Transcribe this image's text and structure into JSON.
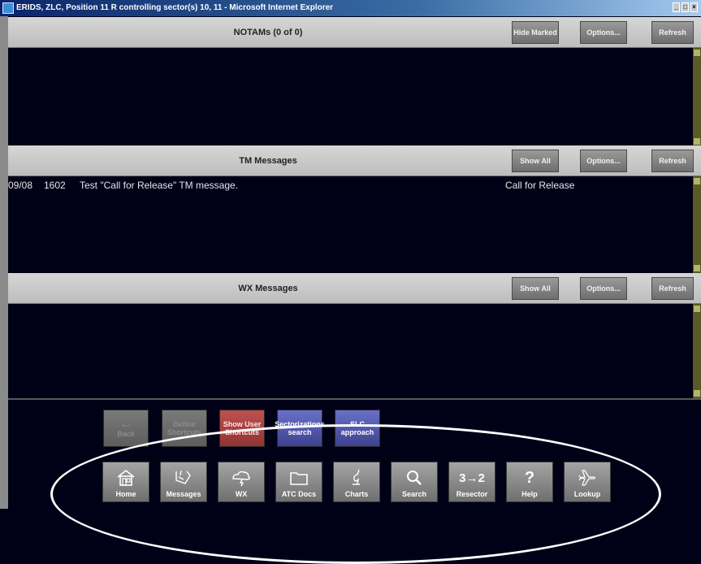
{
  "window": {
    "title": "ERIDS, ZLC, Position 11 R controlling sector(s) 10, 11 - Microsoft Internet Explorer",
    "icon": "ie-icon"
  },
  "notams": {
    "title": "NOTAMs (0 of 0)",
    "buttons": {
      "hide_marked": "Hide Marked",
      "options": "Options...",
      "refresh": "Refresh"
    }
  },
  "tm": {
    "title": "TM Messages",
    "buttons": {
      "show_all": "Show All",
      "options": "Options...",
      "refresh": "Refresh"
    },
    "rows": [
      {
        "date": "09/08",
        "time": "1602",
        "text": "Test \"Call for Release\" TM message.",
        "type": "Call for Release"
      }
    ]
  },
  "wx": {
    "title": "WX Messages",
    "buttons": {
      "show_all": "Show All",
      "options": "Options...",
      "refresh": "Refresh"
    }
  },
  "shortcuts": [
    {
      "label": "Back",
      "icon": "left-arrow-icon",
      "state": "disabled"
    },
    {
      "label": "Define Shortcuts",
      "state": "disabled"
    },
    {
      "label": "Show User Shortcuts",
      "state": "red"
    },
    {
      "label": "Sectorizations search",
      "state": "blue"
    },
    {
      "label": "SLC approach",
      "state": "blue"
    }
  ],
  "nav": [
    {
      "label": "Home",
      "icon": "home-icon"
    },
    {
      "label": "Messages",
      "icon": "messages-icon"
    },
    {
      "label": "WX",
      "icon": "weather-icon"
    },
    {
      "label": "ATC Docs",
      "icon": "folder-icon"
    },
    {
      "label": "Charts",
      "icon": "charts-icon"
    },
    {
      "label": "Search",
      "icon": "search-icon"
    },
    {
      "label": "Resector",
      "icon": "resector-icon",
      "glyph": "3→2"
    },
    {
      "label": "Help",
      "icon": "help-icon",
      "glyph": "?"
    },
    {
      "label": "Lookup",
      "icon": "airplane-icon"
    }
  ],
  "colors": {
    "panel_bg": "#000017",
    "header_bg": "#c8c8c8",
    "button_gray": "#7d7d7d",
    "shortcut_red": "#a84040",
    "shortcut_blue": "#5058b0",
    "annotation": "#ffffff"
  }
}
